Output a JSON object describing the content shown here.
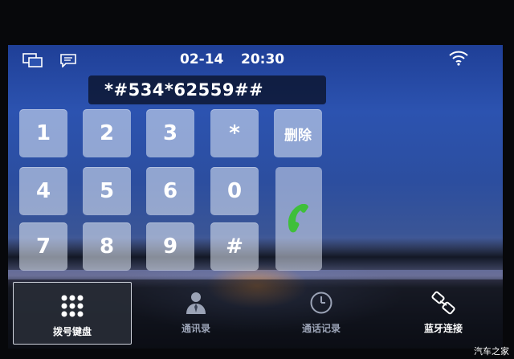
{
  "status": {
    "date": "02-14",
    "time": "20:30"
  },
  "dialer": {
    "number": "*#534*62559##",
    "keys": [
      "1",
      "2",
      "3",
      "*",
      "删除",
      "4",
      "5",
      "6",
      "0",
      "7",
      "8",
      "9",
      "#"
    ]
  },
  "tabs": [
    {
      "label": "拨号键盘",
      "icon": "keypad-icon",
      "active": true
    },
    {
      "label": "通讯录",
      "icon": "contacts-icon",
      "active": false
    },
    {
      "label": "通话记录",
      "icon": "clock-icon",
      "active": false
    },
    {
      "label": "蓝牙连接",
      "icon": "bluetooth-link-icon",
      "active": false
    }
  ],
  "watermark": "汽车之家",
  "colors": {
    "call_green": "#3fbf3a",
    "accent_blue": "#2c53b0"
  }
}
